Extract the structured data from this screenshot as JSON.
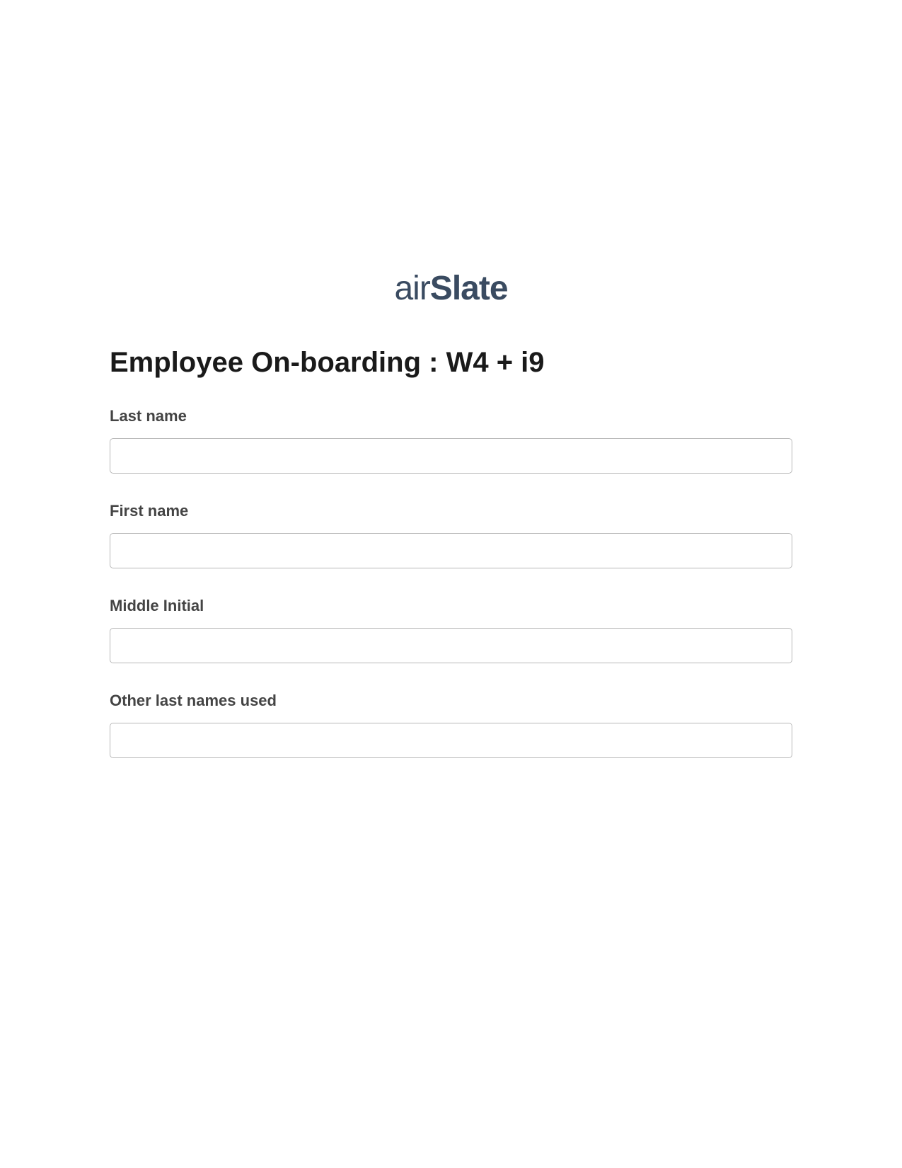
{
  "brand": {
    "name_part1": "air",
    "name_part2": "Slate",
    "color": "#3a4b61"
  },
  "page": {
    "title": "Employee On-boarding : W4 + i9"
  },
  "form": {
    "fields": [
      {
        "label": "Last name",
        "value": ""
      },
      {
        "label": "First name",
        "value": ""
      },
      {
        "label": "Middle Initial",
        "value": ""
      },
      {
        "label": "Other last names used",
        "value": ""
      }
    ]
  }
}
